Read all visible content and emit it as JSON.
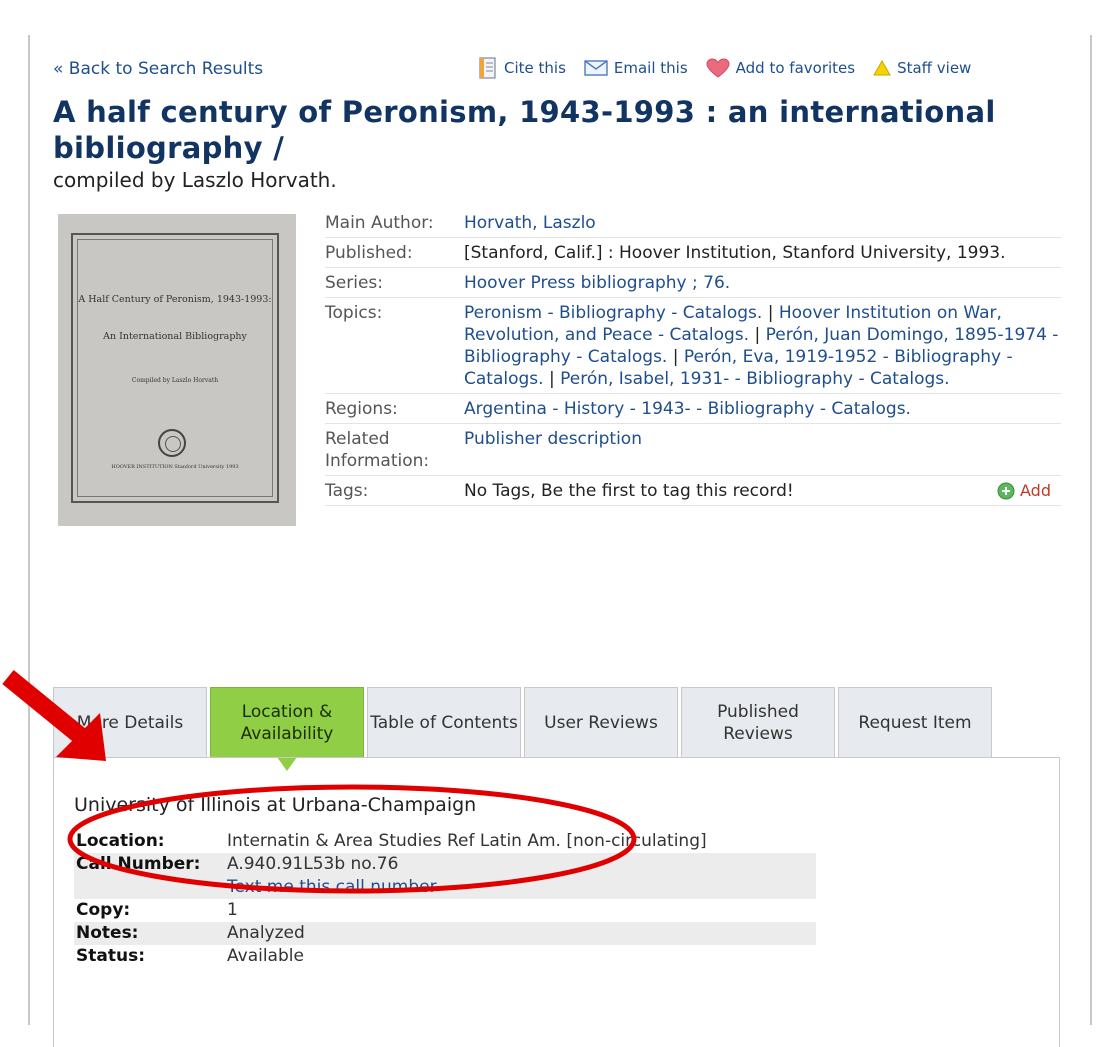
{
  "nav": {
    "back_label": "« Back to Search Results"
  },
  "toolbar": {
    "cite": {
      "label": "Cite this",
      "icon": "document-icon"
    },
    "email": {
      "label": "Email this",
      "icon": "envelope-icon"
    },
    "favorites": {
      "label": "Add to favorites",
      "icon": "heart-icon"
    },
    "staff": {
      "label": "Staff view",
      "icon": "warning-triangle-icon"
    }
  },
  "record": {
    "title": "A half century of Peronism, 1943-1993 : an international bibliography /",
    "subtitle": "compiled by Laszlo Horvath."
  },
  "cover": {
    "line1": "A Half Century of Peronism, 1943-1993:",
    "line2": "An International Bibliography",
    "line3": "Compiled by Laszlo Horvath",
    "line4": "HOOVER INSTITUTION Stanford University 1993"
  },
  "details": {
    "main_author": {
      "label": "Main Author:",
      "value": "Horvath, Laszlo"
    },
    "published": {
      "label": "Published:",
      "value": "[Stanford, Calif.] : Hoover Institution, Stanford University, 1993."
    },
    "series": {
      "label": "Series:",
      "value": "Hoover Press bibliography ; 76."
    },
    "topics": {
      "label": "Topics:",
      "items": [
        "Peronism - Bibliography - Catalogs.",
        "Hoover Institution on War, Revolution, and Peace - Catalogs.",
        "Perón, Juan Domingo, 1895-1974 - Bibliography - Catalogs.",
        "Perón, Eva, 1919-1952 - Bibliography - Catalogs.",
        "Perón, Isabel, 1931- - Bibliography - Catalogs."
      ],
      "separator": " | "
    },
    "regions": {
      "label": "Regions:",
      "value": "Argentina - History - 1943- - Bibliography - Catalogs."
    },
    "related": {
      "label": "Related Information:",
      "value": "Publisher description"
    },
    "tags": {
      "label": "Tags:",
      "value": "No Tags, Be the first to tag this record!",
      "add_label": "Add"
    }
  },
  "tabs": [
    {
      "label": "More Details",
      "active": false
    },
    {
      "label": "Location & Availability",
      "active": true
    },
    {
      "label": "Table of Contents",
      "active": false
    },
    {
      "label": "User Reviews",
      "active": false
    },
    {
      "label": "Published Reviews",
      "active": false
    },
    {
      "label": "Request Item",
      "active": false
    }
  ],
  "holdings": {
    "institution": "University of Illinois at Urbana-Champaign",
    "location": {
      "label": "Location:",
      "value": "Internatin & Area Studies Ref Latin Am. [non-circulating]"
    },
    "call_number": {
      "label": "Call Number:",
      "value": "A.940.91L53b no.76",
      "link": "Text me this call number"
    },
    "copy": {
      "label": "Copy:",
      "value": "1"
    },
    "notes": {
      "label": "Notes:",
      "value": "Analyzed"
    },
    "status": {
      "label": "Status:",
      "value": "Available"
    }
  },
  "colors": {
    "title": "#123463",
    "link": "#1f4e8c",
    "active_tab": "#8fce45",
    "annotation": "#e00000"
  }
}
